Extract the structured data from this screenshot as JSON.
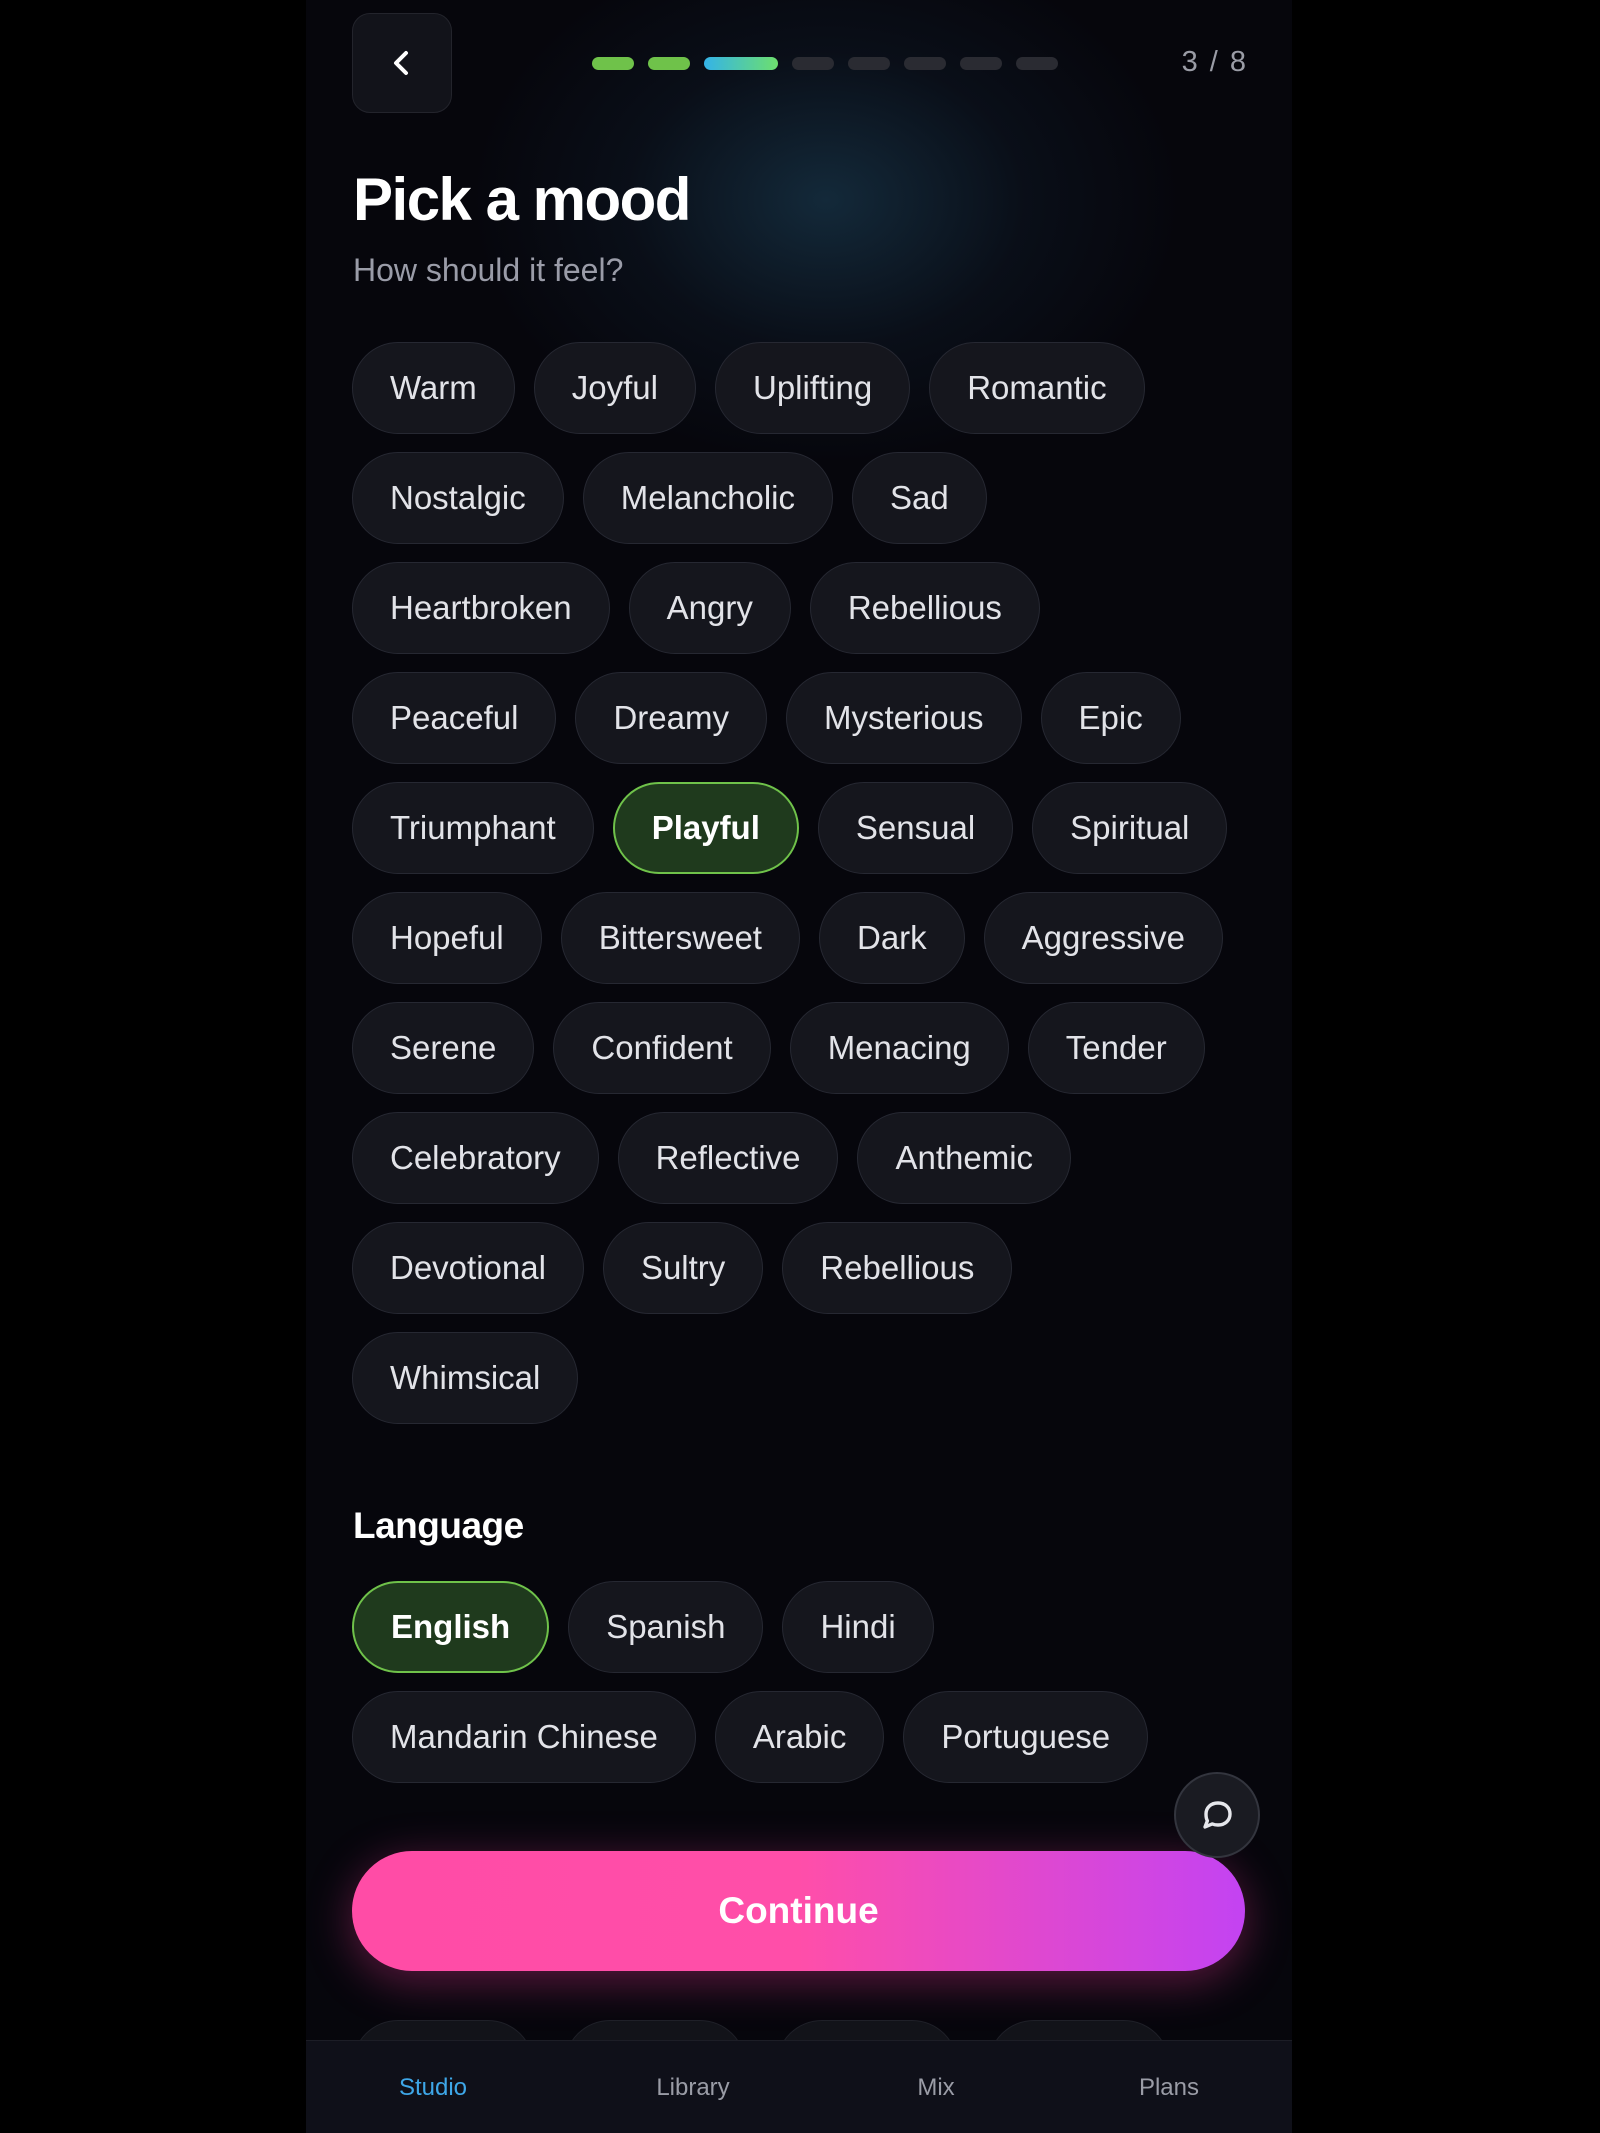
{
  "header": {
    "step_count": "3 / 8",
    "progress": {
      "done": 2,
      "current": 3,
      "total": 8
    }
  },
  "page": {
    "title": "Pick a mood",
    "subtitle": "How should it feel?"
  },
  "moods": {
    "selected": "Playful",
    "items": [
      "Warm",
      "Joyful",
      "Uplifting",
      "Romantic",
      "Nostalgic",
      "Melancholic",
      "Sad",
      "Heartbroken",
      "Angry",
      "Rebellious",
      "Peaceful",
      "Dreamy",
      "Mysterious",
      "Epic",
      "Triumphant",
      "Playful",
      "Sensual",
      "Spiritual",
      "Hopeful",
      "Bittersweet",
      "Dark",
      "Aggressive",
      "Serene",
      "Confident",
      "Menacing",
      "Tender",
      "Celebratory",
      "Reflective",
      "Anthemic",
      "Devotional",
      "Sultry",
      "Rebellious",
      "Whimsical"
    ]
  },
  "language": {
    "title": "Language",
    "selected": "English",
    "items": [
      "English",
      "Spanish",
      "Hindi",
      "Mandarin Chinese",
      "Arabic",
      "Portuguese"
    ]
  },
  "actions": {
    "continue_label": "Continue"
  },
  "nav": {
    "items": [
      {
        "label": "Studio",
        "active": true
      },
      {
        "label": "Library",
        "active": false
      },
      {
        "label": "Mix",
        "active": false
      },
      {
        "label": "Plans",
        "active": false
      }
    ]
  },
  "colors": {
    "accent_green": "#6fc24a",
    "accent_blue": "#3ea7e8",
    "cta_pink": "#ff4ca6",
    "cta_purple": "#c343f2"
  },
  "icons": {
    "back": "chevron-left-icon",
    "chat": "chat-bubble-icon"
  }
}
